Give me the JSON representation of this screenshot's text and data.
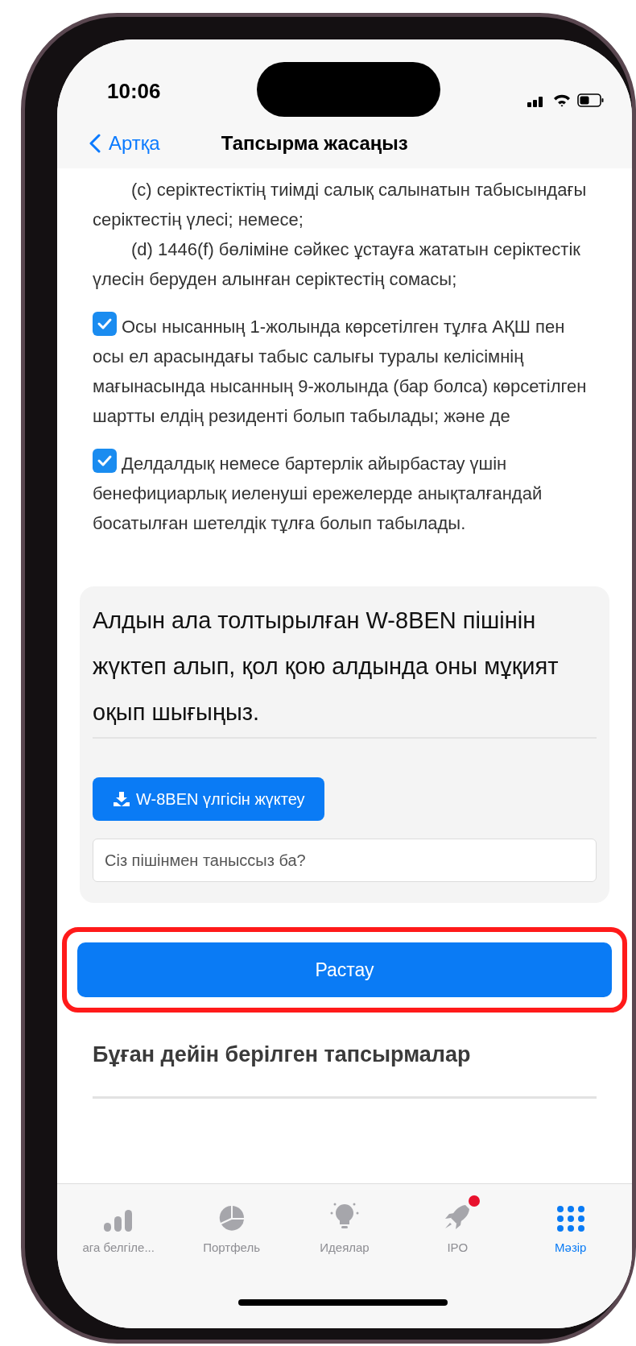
{
  "status_bar": {
    "time": "10:06"
  },
  "nav": {
    "back": "Артқа",
    "title": "Тапсырма жасаңыз"
  },
  "clauses": [
    "(c) серіктестіктің тиімді салық салынатын табысындағы серіктестің үлесі; немесе;",
    "(d) 1446(f) бөліміне сәйкес ұстауға жататын серіктестік үлесін беруден алынған серіктестің сомасы;"
  ],
  "statements": [
    {
      "checked": true,
      "text": "Осы нысанның 1-жолында көрсетілген тұлға АҚШ пен осы ел арасындағы табыс салығы туралы келісімнің мағынасында нысанның 9-жолында (бар болса) көрсетілген шартты елдің резиденті болып табылады; және де"
    },
    {
      "checked": true,
      "text": "Делдалдық немесе бартерлік айырбастау үшін бенефициарлық иеленуші ережелерде анықталғандай босатылған шетелдік тұлға болып табылады."
    }
  ],
  "form_card": {
    "heading": "Алдын ала толтырылған W-8BEN пішінін жүктеп алып, қол қою алдында оны мұқият оқып шығыңыз.",
    "download_button": "W-8BEN үлгісін жүктеу",
    "answer": {
      "placeholder": "Сіз пішінмен таныссыз ба?"
    }
  },
  "confirm_button": {
    "label": "Растау",
    "highlighted": true
  },
  "history": {
    "heading": "Бұған дейін берілген тапсырмалар"
  },
  "tab_bar": [
    {
      "kind": "bars",
      "label": "ага белгіле...",
      "selected": false,
      "badge": false
    },
    {
      "kind": "pie",
      "label": "Портфель",
      "selected": false,
      "badge": false
    },
    {
      "kind": "bulb",
      "label": "Идеялар",
      "selected": false,
      "badge": false
    },
    {
      "kind": "rocket",
      "label": "IPO",
      "selected": false,
      "badge": true
    },
    {
      "kind": "grid",
      "label": "Мәзір",
      "selected": true,
      "badge": false
    }
  ]
}
